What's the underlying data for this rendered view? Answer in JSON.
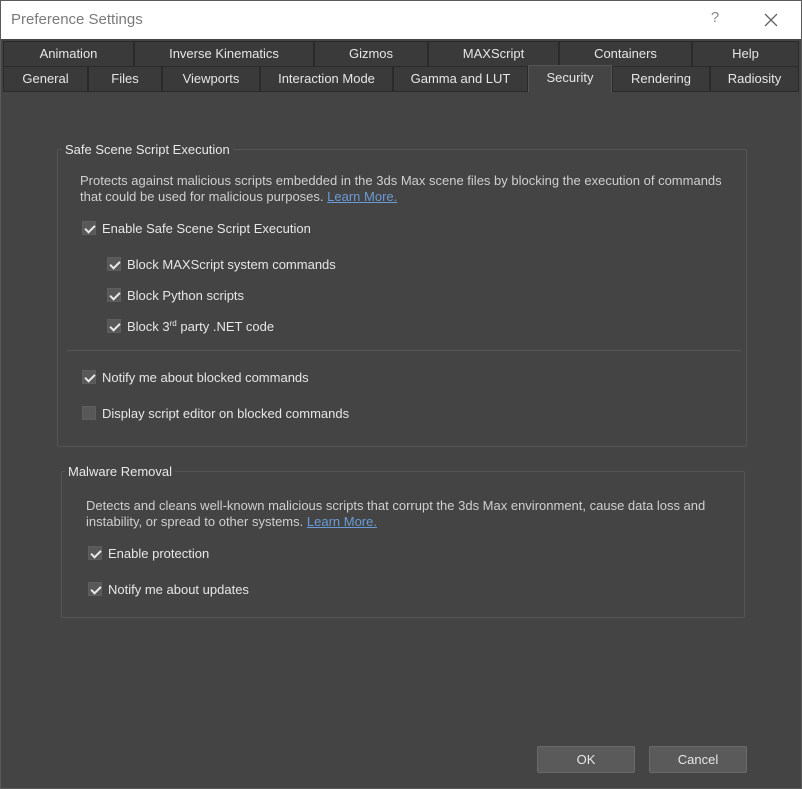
{
  "window": {
    "title": "Preference Settings",
    "help_label": "?"
  },
  "tabs": {
    "row1": [
      "Animation",
      "Inverse Kinematics",
      "Gizmos",
      "MAXScript",
      "Containers",
      "Help"
    ],
    "row2": [
      "General",
      "Files",
      "Viewports",
      "Interaction Mode",
      "Gamma and LUT",
      "Security",
      "Rendering",
      "Radiosity"
    ],
    "active": "Security"
  },
  "safe_scene": {
    "title": "Safe Scene Script Execution",
    "description": "Protects against malicious scripts embedded in the 3ds Max scene files by blocking the execution of commands that could be used for malicious purposes.",
    "learn_more": "Learn More.",
    "enable_label": "Enable Safe Scene Script Execution",
    "block_maxscript_label": "Block MAXScript system commands",
    "block_python_label": "Block Python scripts",
    "block_net_prefix": "Block 3",
    "block_net_sup": "rd",
    "block_net_suffix": " party .NET code",
    "notify_label": "Notify me about blocked commands",
    "display_editor_label": "Display script editor on blocked commands",
    "enable_checked": true,
    "block_maxscript_checked": true,
    "block_python_checked": true,
    "block_net_checked": true,
    "notify_checked": true,
    "display_editor_checked": false
  },
  "malware": {
    "title": "Malware Removal",
    "description": "Detects and cleans well-known malicious scripts that corrupt the 3ds Max environment, cause data loss and instability, or spread to other systems.",
    "learn_more": "Learn More.",
    "enable_label": "Enable protection",
    "notify_label": "Notify me about updates",
    "enable_checked": true,
    "notify_checked": true
  },
  "buttons": {
    "ok": "OK",
    "cancel": "Cancel"
  },
  "colors": {
    "background": "#444444",
    "link": "#6b9bd6",
    "text": "#e6e6e6"
  }
}
